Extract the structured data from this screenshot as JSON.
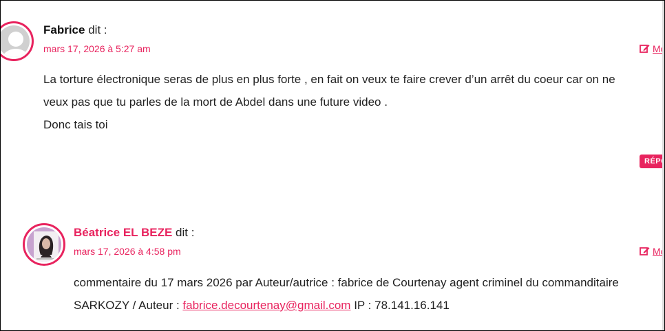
{
  "comments": [
    {
      "author": "Fabrice",
      "says": "dit :",
      "date": "mars 17, 2026 à 5:27 am",
      "edit_label": "Mo",
      "lines": [
        "La torture électronique seras de plus en plus forte , en fait on veux te faire crever d’un arrêt du coeur car on ne",
        "veux pas que tu parles de la mort de Abdel dans une future video .",
        "Donc tais toi"
      ],
      "reply_label": "RÉPO"
    },
    {
      "author": "Béatrice EL BEZE",
      "says": "dit :",
      "date": "mars 17, 2026 à 4:58 pm",
      "edit_label": "Mo",
      "line1": "commentaire du 17 mars 2026 par Auteur/autrice : fabrice de Courtenay agent criminel du commanditaire",
      "line2_prefix": "SARKOZY / Auteur : ",
      "line2_email": "fabrice.decourtenay@gmail.com",
      "line2_suffix": " IP : 78.141.16.141"
    }
  ],
  "colors": {
    "accent": "#e8235e",
    "text": "#222222"
  }
}
